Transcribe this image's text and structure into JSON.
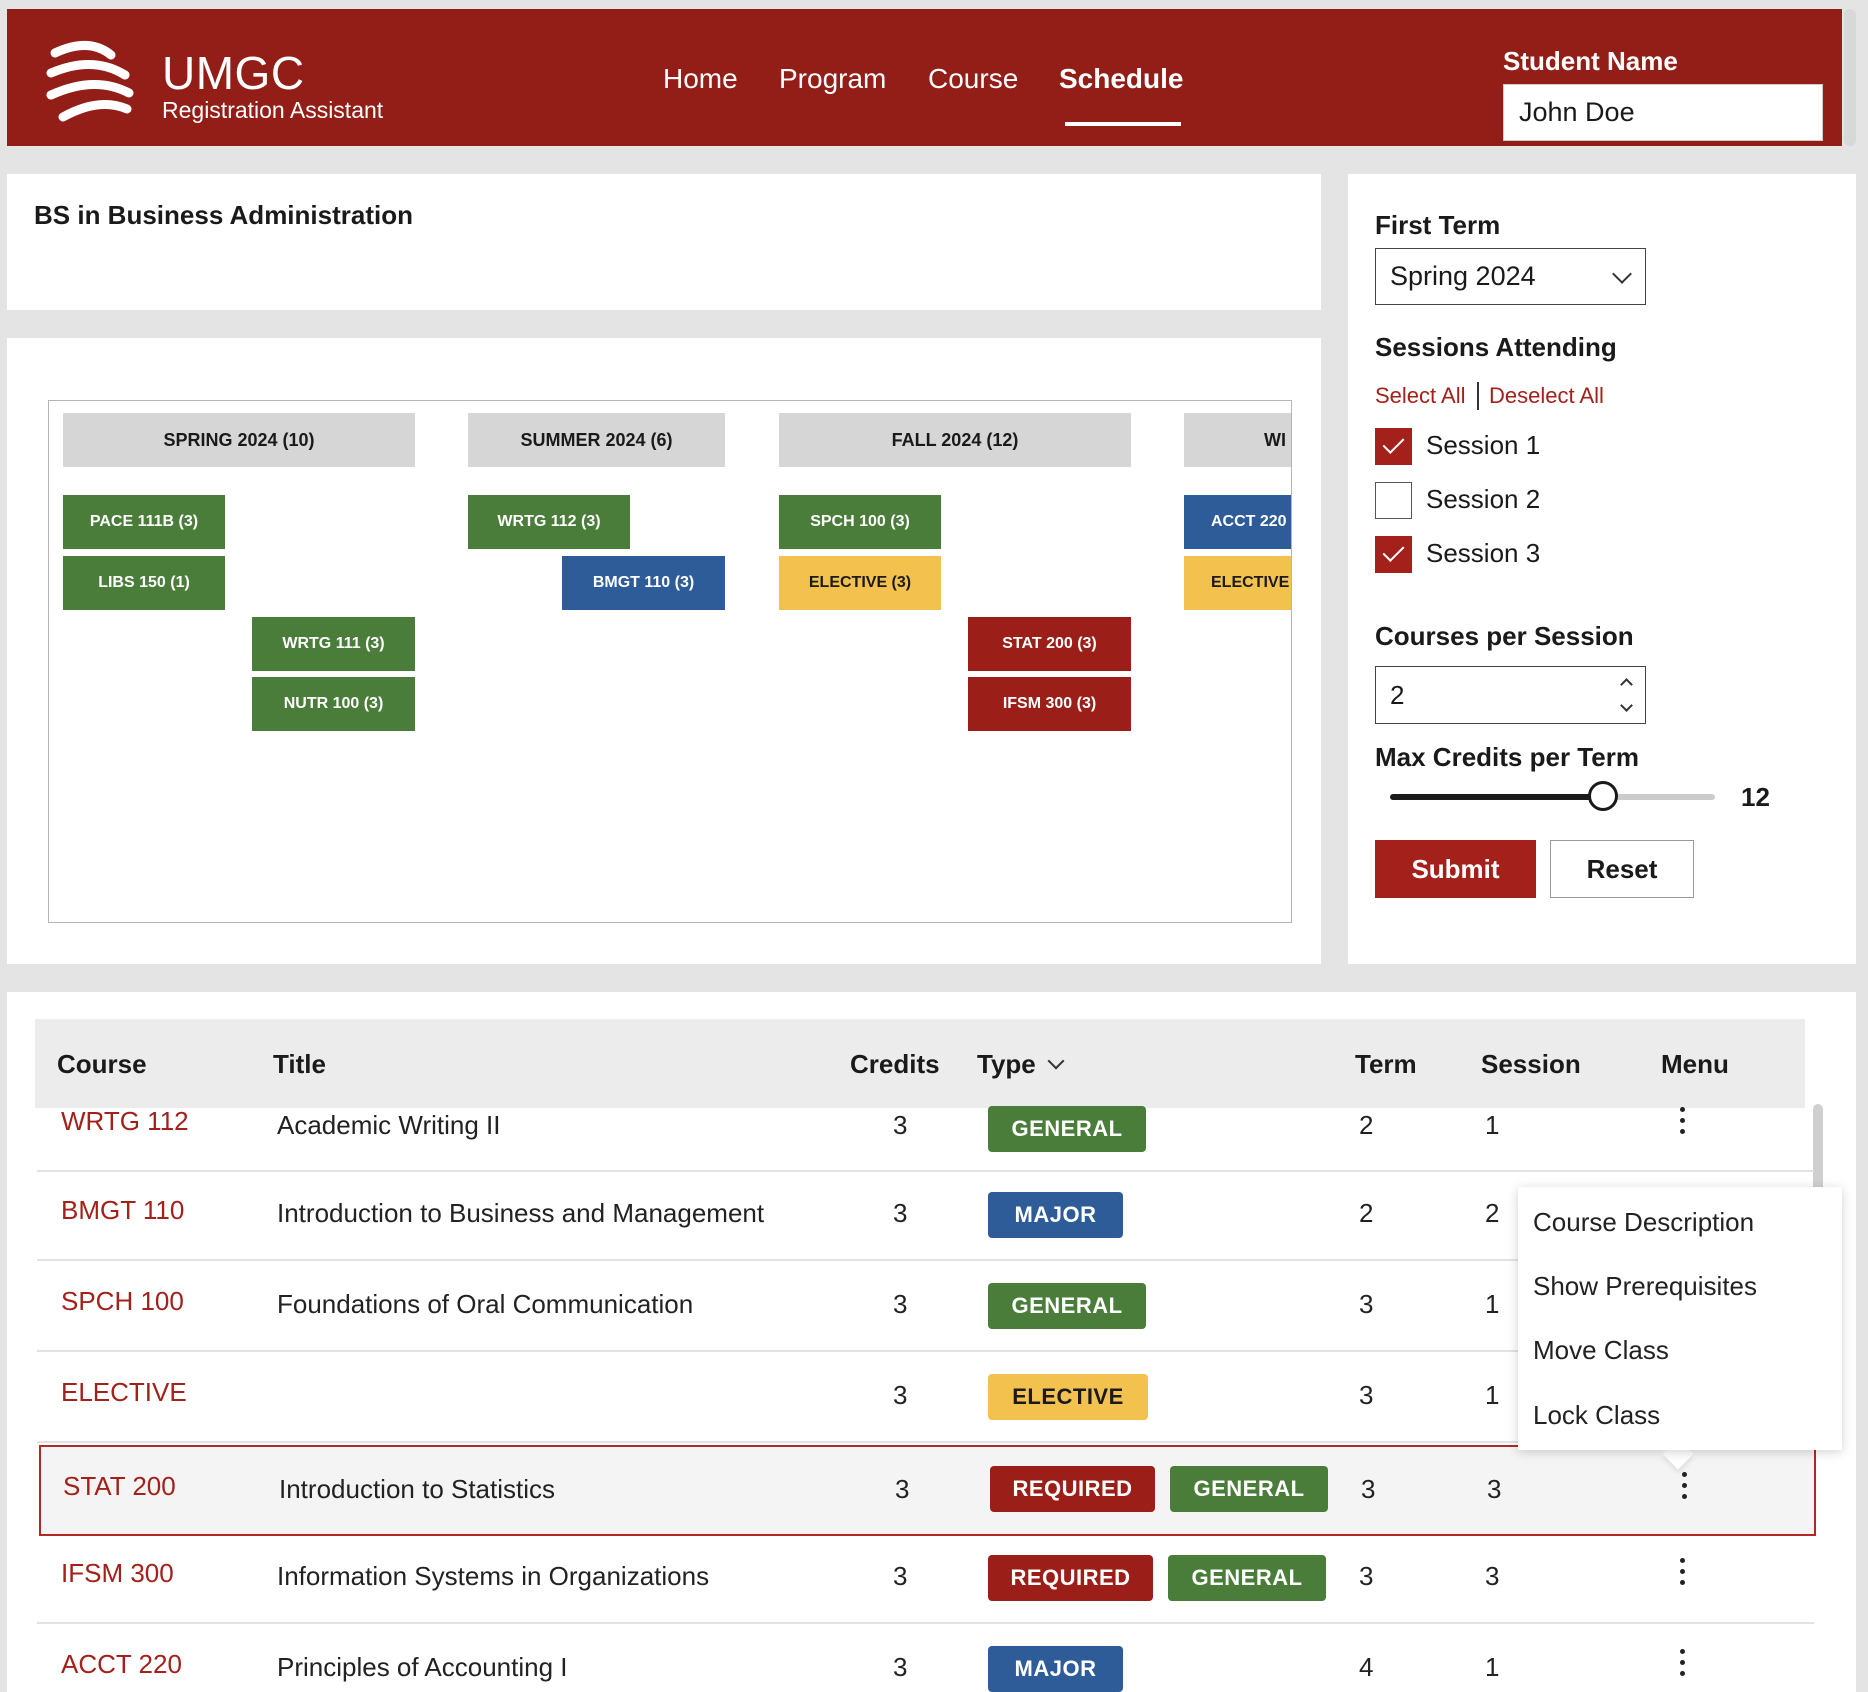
{
  "header": {
    "brand": "UMGC",
    "subtitle": "Registration Assistant",
    "nav": [
      "Home",
      "Program",
      "Course",
      "Schedule"
    ],
    "active_nav": "Schedule",
    "student_label": "Student Name",
    "student_name": "John Doe"
  },
  "program": {
    "title": "BS in Business Administration"
  },
  "schedule_chart": {
    "terms": [
      "SPRING 2024 (10)",
      "SUMMER 2024 (6)",
      "FALL 2024 (12)",
      "WI"
    ],
    "blocks": [
      {
        "label": "PACE 111B (3)",
        "type": "general"
      },
      {
        "label": "LIBS 150 (1)",
        "type": "general"
      },
      {
        "label": "WRTG 111 (3)",
        "type": "general"
      },
      {
        "label": "NUTR 100 (3)",
        "type": "general"
      },
      {
        "label": "WRTG 112 (3)",
        "type": "general"
      },
      {
        "label": "BMGT 110 (3)",
        "type": "major"
      },
      {
        "label": "SPCH 100 (3)",
        "type": "general"
      },
      {
        "label": "ELECTIVE (3)",
        "type": "elective"
      },
      {
        "label": "STAT 200 (3)",
        "type": "required"
      },
      {
        "label": "IFSM 300 (3)",
        "type": "required"
      },
      {
        "label": "ACCT 220",
        "type": "major"
      },
      {
        "label": "ELECTIVE",
        "type": "elective"
      }
    ]
  },
  "settings": {
    "first_term_label": "First Term",
    "first_term_value": "Spring 2024",
    "sessions_label": "Sessions Attending",
    "select_all": "Select All",
    "deselect_all": "Deselect All",
    "sessions": [
      {
        "label": "Session 1",
        "checked": true
      },
      {
        "label": "Session 2",
        "checked": false
      },
      {
        "label": "Session 3",
        "checked": true
      }
    ],
    "courses_per_session_label": "Courses per Session",
    "courses_per_session": "2",
    "max_credits_label": "Max Credits per Term",
    "max_credits": "12",
    "submit": "Submit",
    "reset": "Reset"
  },
  "table": {
    "columns": [
      "Course",
      "Title",
      "Credits",
      "Type",
      "Term",
      "Session",
      "Menu"
    ],
    "rows": [
      {
        "course": "WRTG 112",
        "title": "Academic Writing II",
        "credits": "3",
        "types": [
          "GENERAL"
        ],
        "term": "2",
        "session": "1"
      },
      {
        "course": "BMGT 110",
        "title": "Introduction to Business and Management",
        "credits": "3",
        "types": [
          "MAJOR"
        ],
        "term": "2",
        "session": "2"
      },
      {
        "course": "SPCH 100",
        "title": "Foundations of Oral Communication",
        "credits": "3",
        "types": [
          "GENERAL"
        ],
        "term": "3",
        "session": "1"
      },
      {
        "course": "ELECTIVE",
        "title": "",
        "credits": "3",
        "types": [
          "ELECTIVE"
        ],
        "term": "3",
        "session": "1"
      },
      {
        "course": "STAT 200",
        "title": "Introduction to Statistics",
        "credits": "3",
        "types": [
          "REQUIRED",
          "GENERAL"
        ],
        "term": "3",
        "session": "3"
      },
      {
        "course": "IFSM 300",
        "title": "Information Systems in Organizations",
        "credits": "3",
        "types": [
          "REQUIRED",
          "GENERAL"
        ],
        "term": "3",
        "session": "3"
      },
      {
        "course": "ACCT 220",
        "title": "Principles of Accounting I",
        "credits": "3",
        "types": [
          "MAJOR"
        ],
        "term": "4",
        "session": "1"
      }
    ]
  },
  "context_menu": {
    "items": [
      "Course Description",
      "Show Prerequisites",
      "Move Class",
      "Lock Class"
    ]
  },
  "colors": {
    "brand": "#931e17",
    "general": "#4a7d3a",
    "major": "#2e5c98",
    "elective": "#f2c14e",
    "required": "#9b1f18"
  }
}
